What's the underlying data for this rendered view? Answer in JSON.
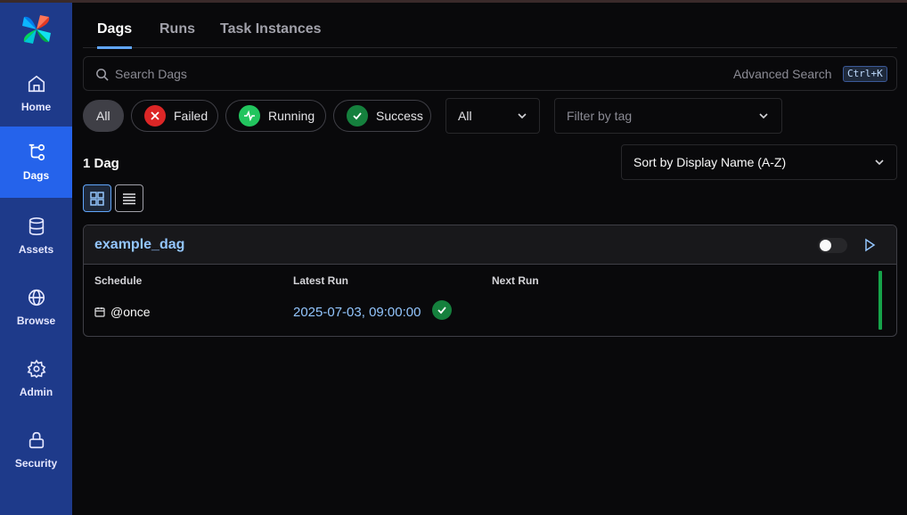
{
  "sidebar": {
    "items": [
      {
        "label": "Home",
        "icon": "home-icon"
      },
      {
        "label": "Dags",
        "icon": "dags-icon",
        "active": true
      },
      {
        "label": "Assets",
        "icon": "database-icon"
      },
      {
        "label": "Browse",
        "icon": "globe-icon"
      },
      {
        "label": "Admin",
        "icon": "gear-icon"
      },
      {
        "label": "Security",
        "icon": "lock-icon"
      }
    ]
  },
  "tabs": [
    {
      "label": "Dags",
      "active": true
    },
    {
      "label": "Runs"
    },
    {
      "label": "Task Instances"
    }
  ],
  "search": {
    "placeholder": "Search Dags",
    "advanced_label": "Advanced Search",
    "shortcut": "Ctrl+K"
  },
  "filters": {
    "state_pills": [
      {
        "label": "All",
        "active": true
      },
      {
        "label": "Failed",
        "color": "#dc2626",
        "icon": "x-icon"
      },
      {
        "label": "Running",
        "color": "#22c55e",
        "icon": "pulse-icon"
      },
      {
        "label": "Success",
        "color": "#15803d",
        "icon": "check-icon"
      }
    ],
    "paused_select": "All",
    "tag_placeholder": "Filter by tag"
  },
  "sort": {
    "label": "Sort by Display Name (A-Z)"
  },
  "count_label": "1 Dag",
  "view_modes": [
    "grid",
    "list"
  ],
  "dags": [
    {
      "name": "example_dag",
      "paused": true,
      "columns": {
        "schedule": "Schedule",
        "latest_run": "Latest Run",
        "next_run": "Next Run"
      },
      "schedule": "@once",
      "latest_run": "2025-07-03, 09:00:00",
      "latest_run_state": "success",
      "next_run": ""
    }
  ],
  "colors": {
    "sidebar": "#1e3a8a",
    "sidebar_active": "#2563eb",
    "accent": "#60a5fa",
    "link": "#93c5fd",
    "success": "#15803d"
  }
}
